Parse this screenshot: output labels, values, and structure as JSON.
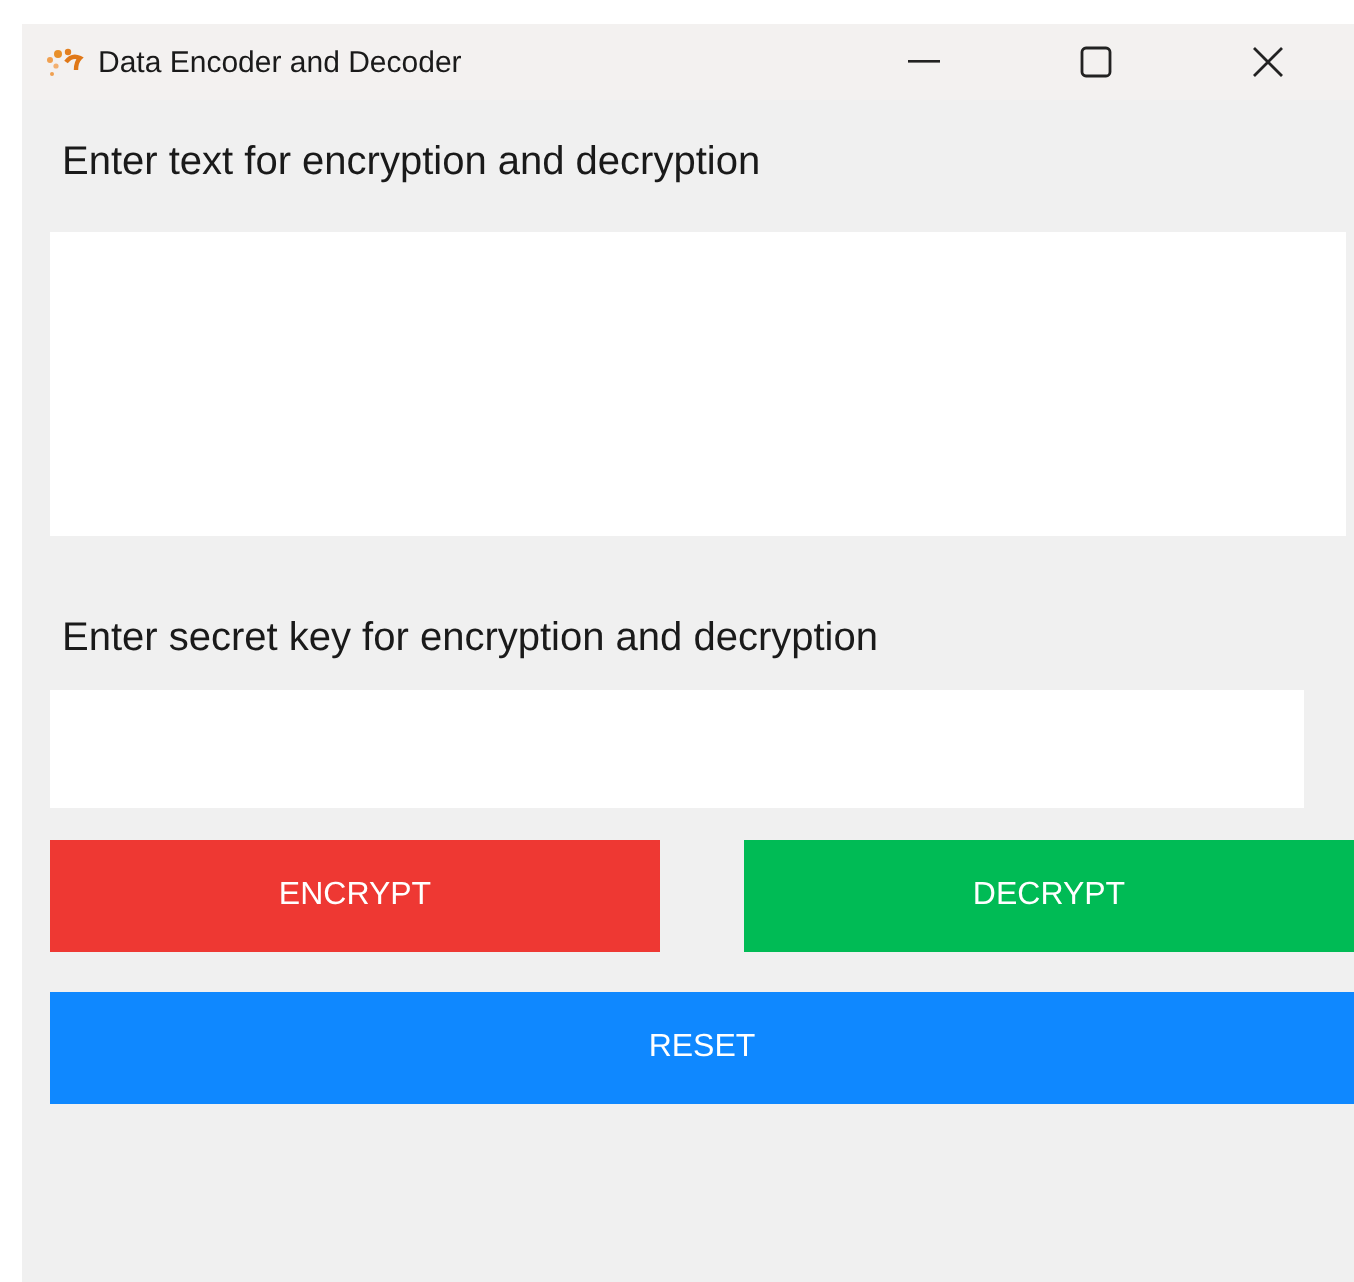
{
  "window": {
    "title": "Data Encoder and Decoder"
  },
  "text_section": {
    "label": "Enter text for encryption and decryption"
  },
  "key_section": {
    "label": "Enter secret key for encryption and decryption"
  },
  "button_rows": [
    {
      "buttons": [
        {
          "label": "ENCRYPT",
          "color": "#ee3833"
        },
        {
          "label": "DECRYPT",
          "color": "#00bb55"
        }
      ]
    },
    {
      "buttons": [
        {
          "label": "RESET",
          "color": "#0f88ff"
        }
      ]
    }
  ]
}
